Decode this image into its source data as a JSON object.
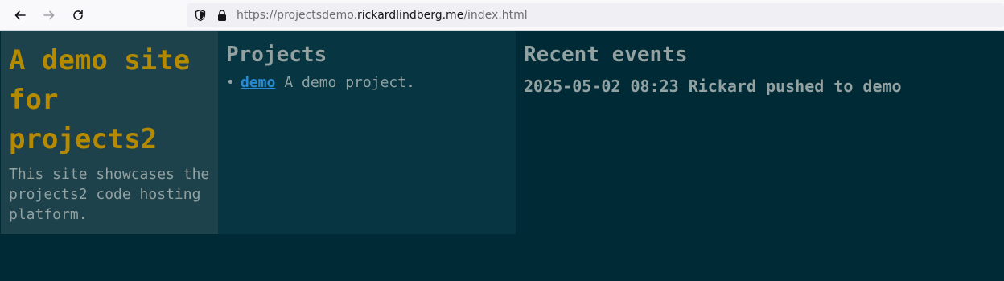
{
  "browser": {
    "url_prefix": "https://projectsdemo.",
    "url_domain": "rickardlindberg.me",
    "url_path": "/index.html",
    "icons": [
      "back-arrow-icon",
      "forward-arrow-icon",
      "reload-icon",
      "shield-icon",
      "lock-icon"
    ]
  },
  "intro": {
    "title": "A demo site for projects2",
    "description": "This site showcases the projects2 code hosting platform."
  },
  "projects": {
    "heading": "Projects",
    "items": [
      {
        "name": "demo",
        "description": "A demo project."
      }
    ]
  },
  "events": {
    "heading": "Recent events",
    "items": [
      {
        "text": "2025-05-02 08:23 Rickard pushed to demo"
      }
    ]
  },
  "colors": {
    "title": "#b58900",
    "text": "#93a1a1",
    "link": "#268bd2",
    "background": "#002b36",
    "panel": "#073642",
    "panel_intro": "#1d424b"
  }
}
